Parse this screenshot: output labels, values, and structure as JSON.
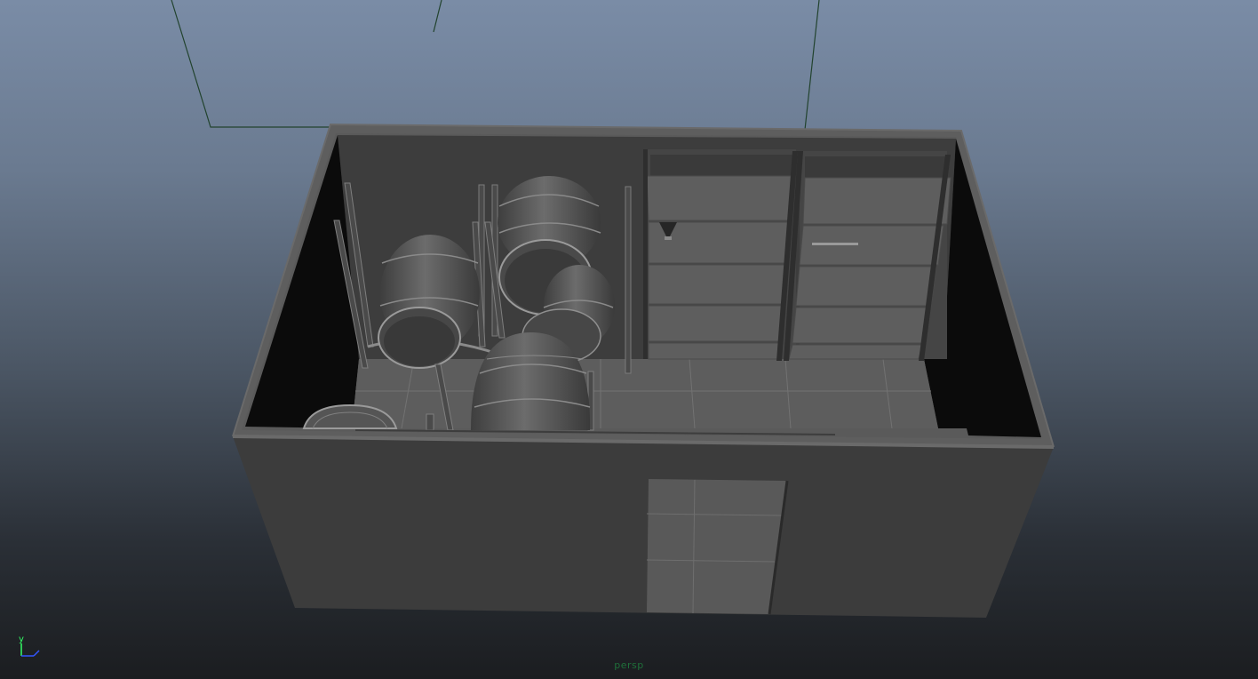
{
  "viewport": {
    "camera_name": "persp",
    "axis_labels": {
      "y": "y"
    },
    "colors": {
      "background_top": "#7a8ca6",
      "background_bottom": "#1b1d20",
      "camera_label": "#1f6f3a",
      "axis_y": "#33ff66",
      "axis_z": "#3355ff"
    }
  },
  "scene_objects": [
    "room-shell",
    "barrel-rack-left",
    "barrel-rack-center",
    "barrel-rack-front",
    "wooden-barrel",
    "storage-shelf-left",
    "storage-shelf-right",
    "door-opening",
    "camera-frustum"
  ]
}
